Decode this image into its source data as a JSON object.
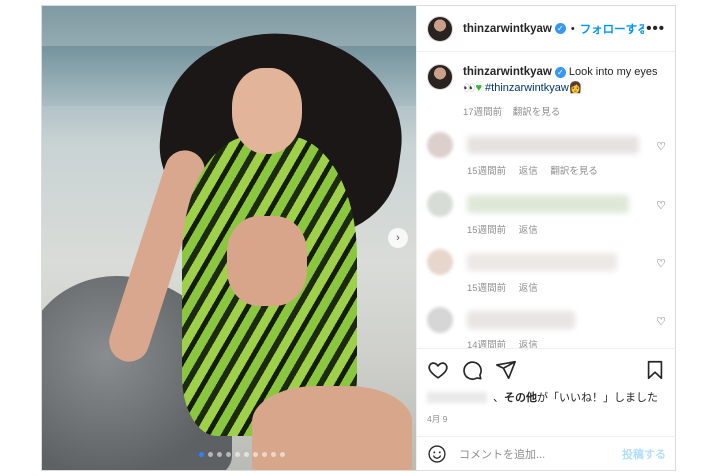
{
  "header": {
    "username": "thinzarwintkyaw",
    "separator": "•",
    "follow_label": "フォローする",
    "more_label": "•••"
  },
  "caption": {
    "username": "thinzarwintkyaw",
    "text": "Look into my eyes",
    "emoji_line_prefix": "👀",
    "hashtag": "#thinzarwintkyaw",
    "time": "17週間前",
    "translate": "翻訳を見る"
  },
  "comments": [
    {
      "time": "15週間前",
      "reply": "返信",
      "translate": "翻訳を見る"
    },
    {
      "time": "15週間前",
      "reply": "返信"
    },
    {
      "time": "15週間前",
      "reply": "返信"
    },
    {
      "time": "14週間前",
      "reply": "返信"
    }
  ],
  "likes": {
    "text_suffix": "、",
    "others": "その他",
    "rest": "が「いいね！」しました"
  },
  "date": "4月 9",
  "add_comment": {
    "placeholder": "コメントを追加...",
    "post_label": "投稿する"
  },
  "colors": {
    "accent": "#0095f6",
    "verified": "#3897f0",
    "muted": "#8e8e8e"
  },
  "icons": [
    "more-icon",
    "verified-icon",
    "heart-icon",
    "comment-icon",
    "share-icon",
    "bookmark-icon",
    "emoji-icon",
    "next-arrow-icon"
  ]
}
